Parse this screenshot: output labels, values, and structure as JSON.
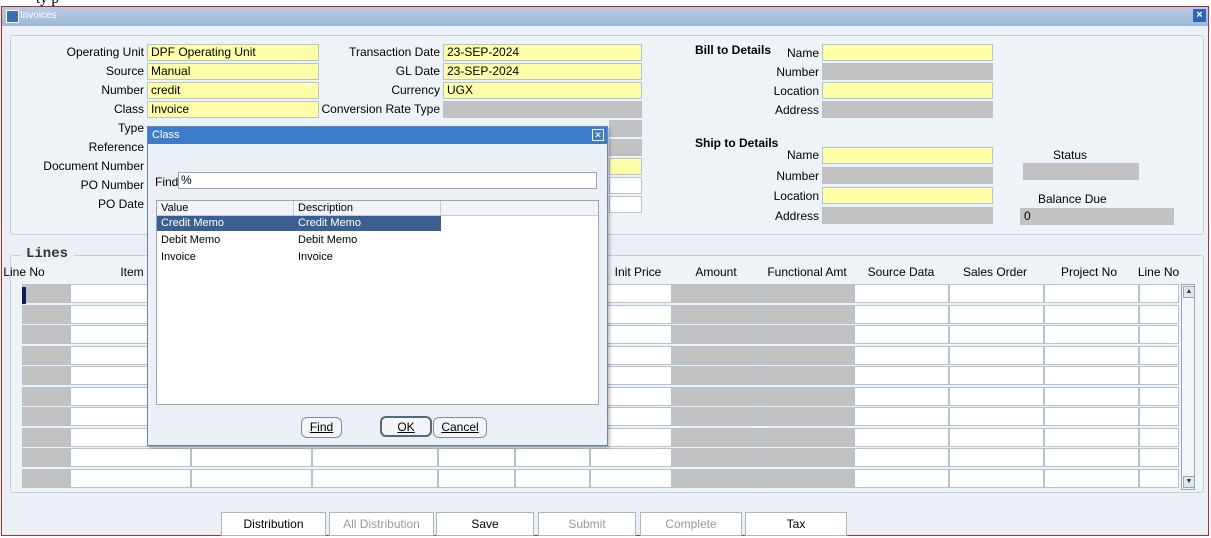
{
  "external_text": "ty p",
  "window": {
    "title": "Invoices"
  },
  "header_left": {
    "fields": [
      {
        "label": "Operating Unit",
        "value": "DPF Operating Unit"
      },
      {
        "label": "Source",
        "value": "Manual"
      },
      {
        "label": "Number",
        "value": "credit"
      },
      {
        "label": "Class",
        "value": "Invoice"
      },
      {
        "label": "Type",
        "value": ""
      },
      {
        "label": "Reference",
        "value": ""
      },
      {
        "label": "Document Number",
        "value": ""
      },
      {
        "label": "PO Number",
        "value": ""
      },
      {
        "label": "PO Date",
        "value": ""
      }
    ]
  },
  "header_mid": {
    "fields": [
      {
        "label": "Transaction Date",
        "value": "23-SEP-2024"
      },
      {
        "label": "GL Date",
        "value": "23-SEP-2024"
      },
      {
        "label": "Currency",
        "value": "UGX"
      },
      {
        "label": "Conversion Rate Type",
        "value": ""
      }
    ]
  },
  "bill_to": {
    "heading": "Bill to Details",
    "fields": [
      {
        "label": "Name",
        "value": ""
      },
      {
        "label": "Number",
        "value": ""
      },
      {
        "label": "Location",
        "value": ""
      },
      {
        "label": "Address",
        "value": ""
      }
    ]
  },
  "ship_to": {
    "heading": "Ship to Details",
    "fields": [
      {
        "label": "Name",
        "value": ""
      },
      {
        "label": "Number",
        "value": ""
      },
      {
        "label": "Location",
        "value": ""
      },
      {
        "label": "Address",
        "value": ""
      }
    ]
  },
  "status": {
    "label": "Status",
    "value": ""
  },
  "balance_due": {
    "label": "Balance Due",
    "value": "0"
  },
  "lines": {
    "title": "Lines",
    "columns": [
      "Line No",
      "Item",
      "Init Price",
      "Amount",
      "Functional Amt",
      "Source Data",
      "Sales Order",
      "Project No",
      "Line No"
    ]
  },
  "buttons": {
    "distribution": "Distribution",
    "all_distribution": "All Distribution",
    "save": "Save",
    "submit": "Submit",
    "complete": "Complete",
    "tax": "Tax"
  },
  "dialog": {
    "title": "Class",
    "find_label": "Find",
    "find_value": "%",
    "columns": [
      "Value",
      "Description"
    ],
    "rows": [
      {
        "value": "Credit Memo",
        "description": "Credit Memo",
        "selected": true
      },
      {
        "value": "Debit Memo",
        "description": "Debit Memo",
        "selected": false
      },
      {
        "value": "Invoice",
        "description": "Invoice",
        "selected": false
      }
    ],
    "find_button": "Find",
    "ok_button": "OK",
    "cancel_button": "Cancel"
  }
}
